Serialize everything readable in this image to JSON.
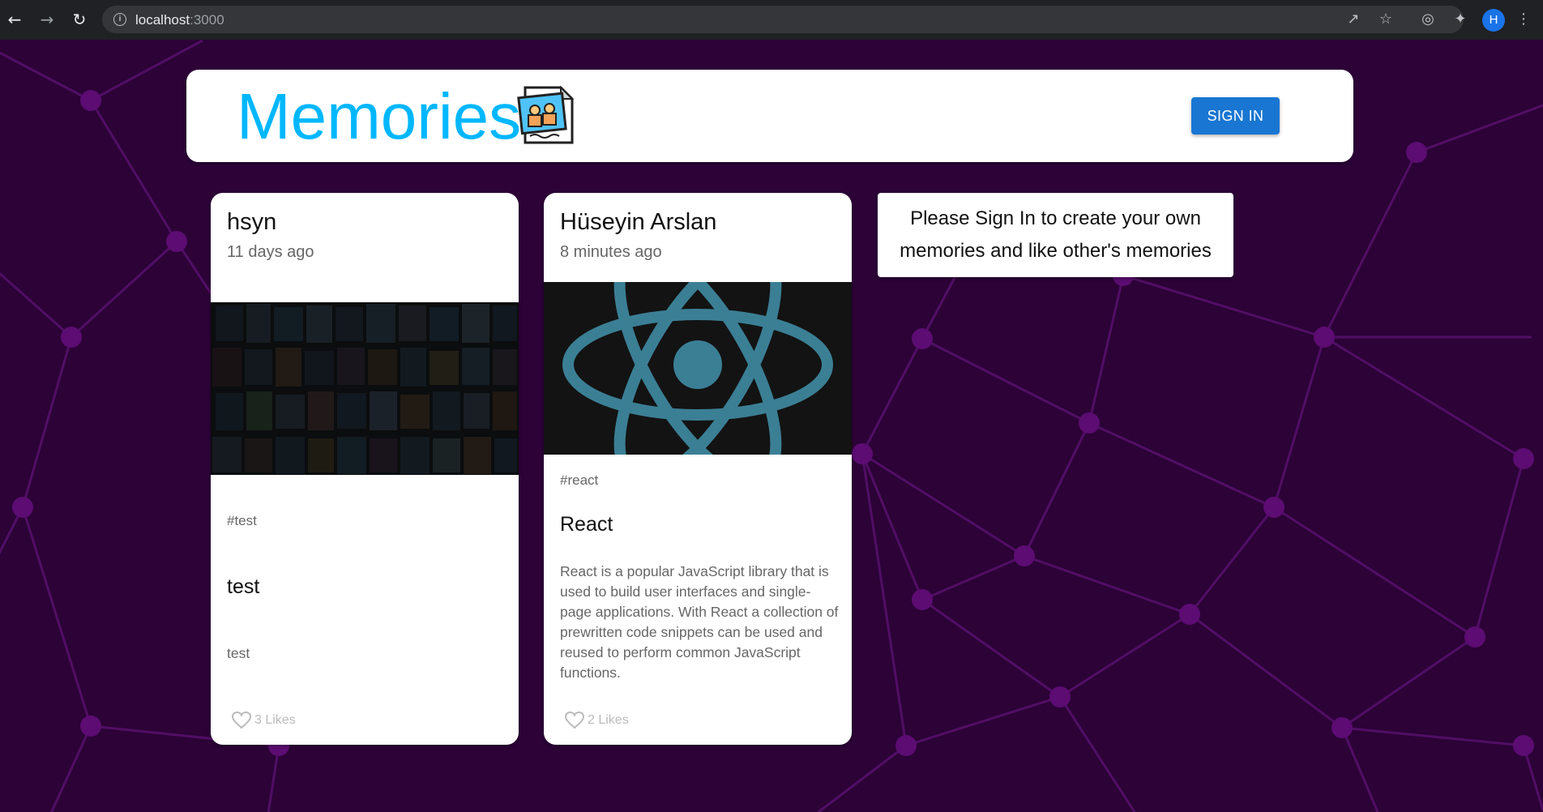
{
  "browser": {
    "url_host": "localhost",
    "url_port": ":3000",
    "profile_initial": "H"
  },
  "app": {
    "brand": "Memories",
    "signin_label": "SIGN IN",
    "notice": "Please Sign In to create your own memories and like other's memories"
  },
  "posts": [
    {
      "author": "hsyn",
      "time": "11 days ago",
      "tags": "#test",
      "title": "test",
      "message": "test",
      "likes": "3 Likes"
    },
    {
      "author": "Hüseyin Arslan",
      "time": "8 minutes ago",
      "tags": "#react",
      "title": "React",
      "message": "React is a popular JavaScript library that is used to build user interfaces and single-page applications. With React a collection of prewritten code snippets can be used and reused to perform common JavaScript functions.",
      "likes": "2 Likes"
    }
  ],
  "colors": {
    "background": "#2c0237",
    "network_line": "#5a0e6c",
    "brand": "#00b7ff",
    "button": "#1976d2",
    "react_logo": "#3b7f95"
  }
}
